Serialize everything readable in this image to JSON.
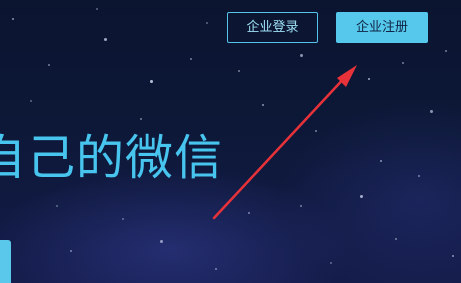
{
  "header": {
    "login_button": "企业登录",
    "register_button": "企业注册"
  },
  "hero": {
    "headline": "自己的微信"
  },
  "colors": {
    "accent": "#55c8ec",
    "background": "#0d1838",
    "annotation_arrow": "#e8323a"
  },
  "icons": {
    "annotation": "red-arrow-icon"
  }
}
